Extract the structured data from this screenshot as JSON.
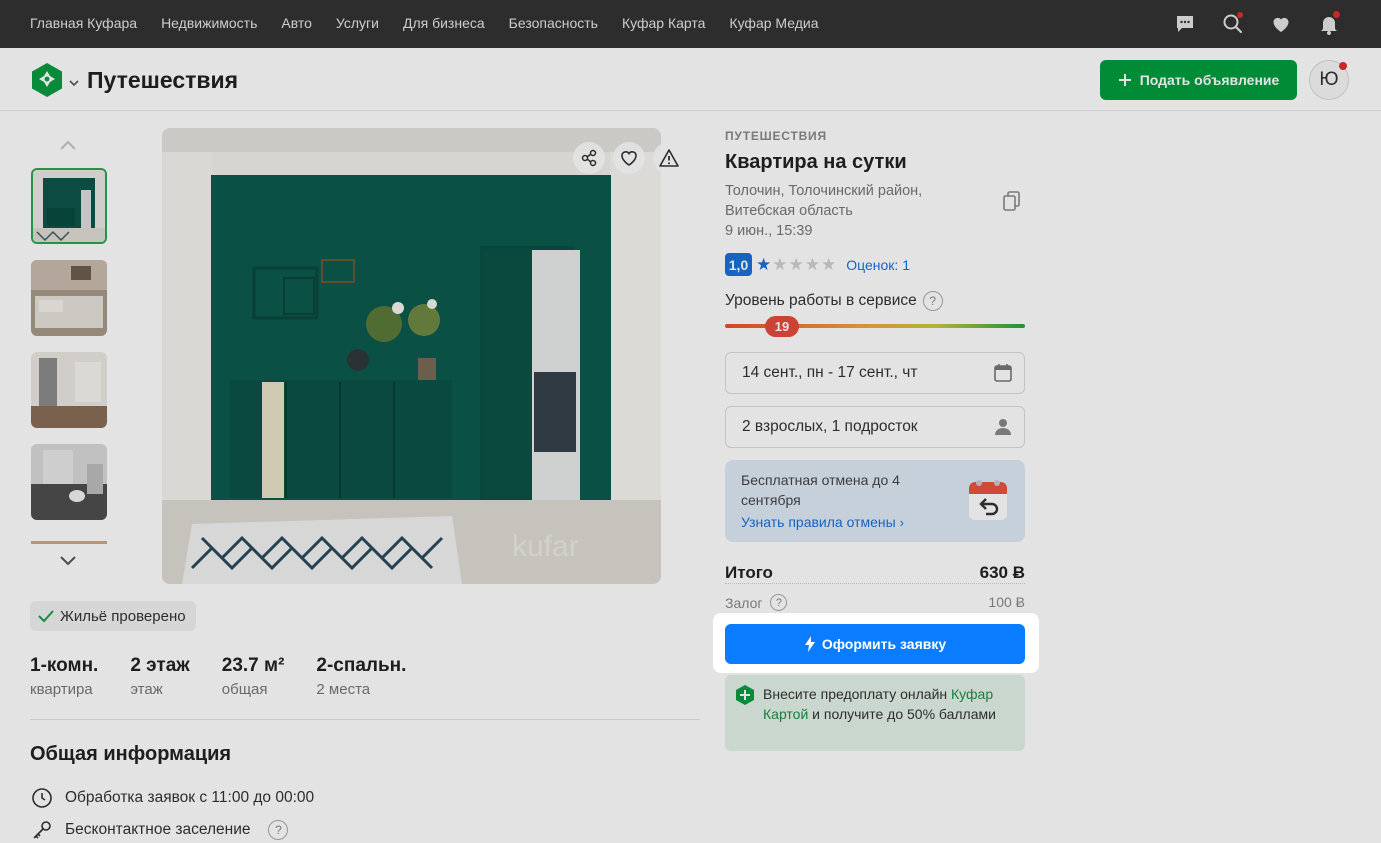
{
  "topnav": {
    "links": [
      "Главная Куфара",
      "Недвижимость",
      "Авто",
      "Услуги",
      "Для бизнеса",
      "Безопасность",
      "Куфар Карта",
      "Куфар Медиа"
    ],
    "icons": [
      "chat-icon",
      "search-heart-icon",
      "heart-icon",
      "bell-icon"
    ]
  },
  "header": {
    "title": "Путешествия",
    "post_button": "Подать объявление",
    "avatar_letter": "Ю"
  },
  "gallery": {
    "watermark": "kufar"
  },
  "listing": {
    "verified": "Жильё проверено",
    "specs": [
      {
        "value": "1-комн.",
        "label": "квартира"
      },
      {
        "value": "2 этаж",
        "label": "этаж"
      },
      {
        "value": "23.7 м²",
        "label": "общая"
      },
      {
        "value": "2-спальн.",
        "label": "2 места"
      }
    ],
    "section_title": "Общая информация",
    "info": [
      {
        "text": "Обработка заявок с 11:00 до 00:00"
      },
      {
        "text": "Бесконтактное заселение"
      }
    ]
  },
  "ad": {
    "category": "ПУТЕШЕСТВИЯ",
    "title": "Квартира на сутки",
    "location_line1": "Толочин, Толочинский район,",
    "location_line2": "Витебская область",
    "date": "9 июн., 15:39",
    "rating": "1,0",
    "rating_stars": 1,
    "rating_count": "Оценок: 1",
    "service_label": "Уровень работы в сервисе",
    "service_score": "19",
    "dates": "14 сент., пн - 17 сент., чт",
    "guests": "2 взрослых, 1 подросток",
    "cancel_text": "Бесплатная отмена до 4 сентября",
    "cancel_link": "Узнать правила отмены",
    "total_label": "Итого",
    "total_value": "630 Ƀ",
    "deposit_label": "Залог",
    "deposit_value": "100 Ƀ",
    "cta": "Оформить заявку",
    "promo_part1": "Внесите предоплату онлайн ",
    "promo_link": "Куфар Картой",
    "promo_part2": " и получите до 50% баллами"
  },
  "colors": {
    "brand_green": "#009e3e",
    "cta_blue": "#0a7cff",
    "link_blue": "#1a70d8",
    "topnav_bg": "#333333"
  }
}
